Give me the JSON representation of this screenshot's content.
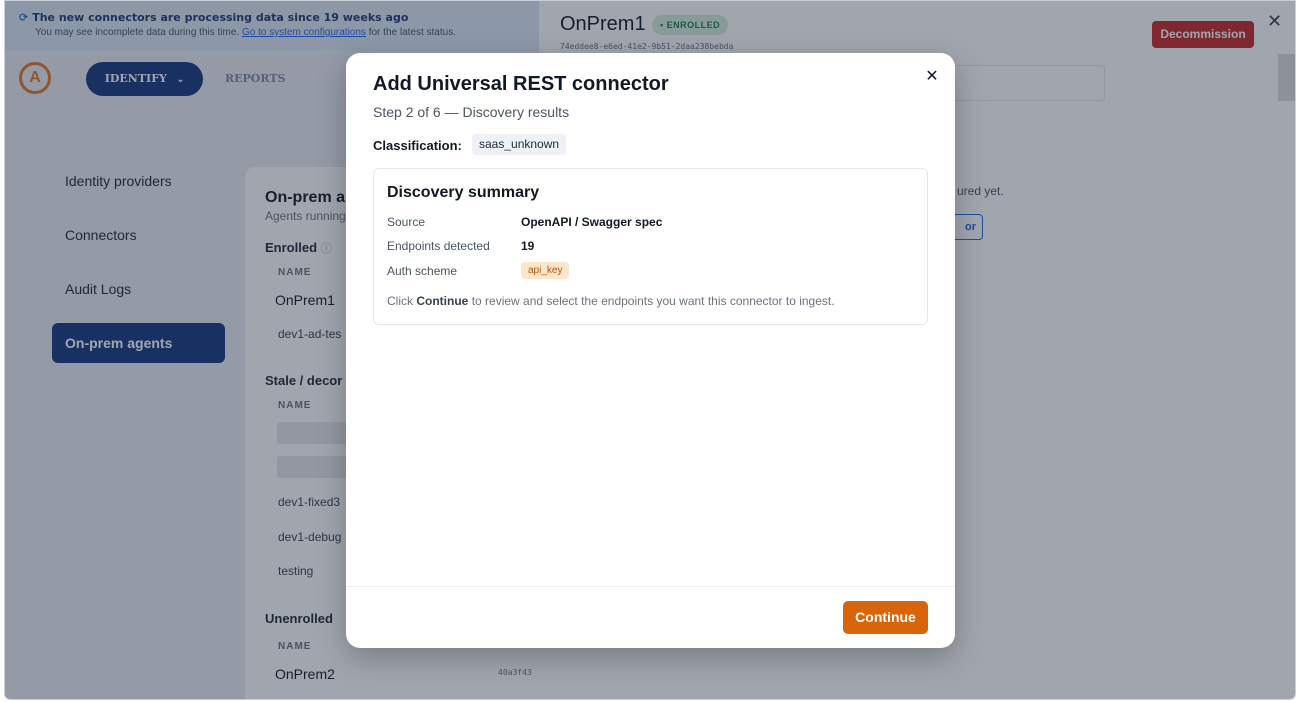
{
  "banner": {
    "title": "The new connectors are processing data since 19 weeks ago",
    "text_before": "You may see incomplete data during this time.",
    "link": "Go to system configurations",
    "text_after": "for the latest status."
  },
  "nav": {
    "identify_label": "IDENTIFY",
    "reports_label": "REPORTS"
  },
  "sidebar": {
    "items": [
      {
        "label": "Identity providers"
      },
      {
        "label": "Connectors"
      },
      {
        "label": "Audit Logs"
      },
      {
        "label": "On-prem agents"
      }
    ]
  },
  "panel": {
    "title": "On-prem a",
    "subtitle": "Agents running",
    "enrolled_label": "Enrolled",
    "col_name": "NAME",
    "enrolled_rows": [
      "OnPrem1",
      "dev1-ad-tes"
    ],
    "stale_label": "Stale / decor",
    "stale_rows": [
      "dev1-fixed3",
      "dev1-debug",
      "testing"
    ],
    "unenrolled_label": "Unenrolled",
    "unenrolled_rows": [
      "OnPrem2"
    ],
    "unenrolled_hash": "40a3f43"
  },
  "drawer": {
    "title": "OnPrem1",
    "badge": "• ENROLLED",
    "hash": "74eddee8-e6ed-41e2-9b51-2daa238bebda",
    "decommission_label": "Decommission",
    "close_glyph": "✕",
    "note": "ured yet.",
    "button_fragment": "or"
  },
  "modal": {
    "title": "Add Universal REST connector",
    "step": "Step 2 of 6 — Discovery results",
    "close_glyph": "✕",
    "classification_label": "Classification:",
    "classification_value": "saas_unknown",
    "summary": {
      "title": "Discovery summary",
      "rows": [
        {
          "key": "Source",
          "value": "OpenAPI / Swagger spec"
        },
        {
          "key": "Endpoints detected",
          "value": "19"
        },
        {
          "key": "Auth scheme",
          "value": "api_key"
        }
      ],
      "hint_before": "Click",
      "hint_bold": "Continue",
      "hint_after": "to review and select the endpoints you want this connector to ingest."
    },
    "continue_label": "Continue"
  },
  "colors": {
    "nav_active": "#15387f",
    "primary_action": "#d9650b",
    "danger": "#c62828",
    "enrolled_badge": "#d3f0dc"
  },
  "icons": {
    "logo": "logo-icon",
    "spinner": "sync-icon",
    "chevron": "chevron-down-icon",
    "close": "close-icon",
    "info": "info-icon"
  }
}
